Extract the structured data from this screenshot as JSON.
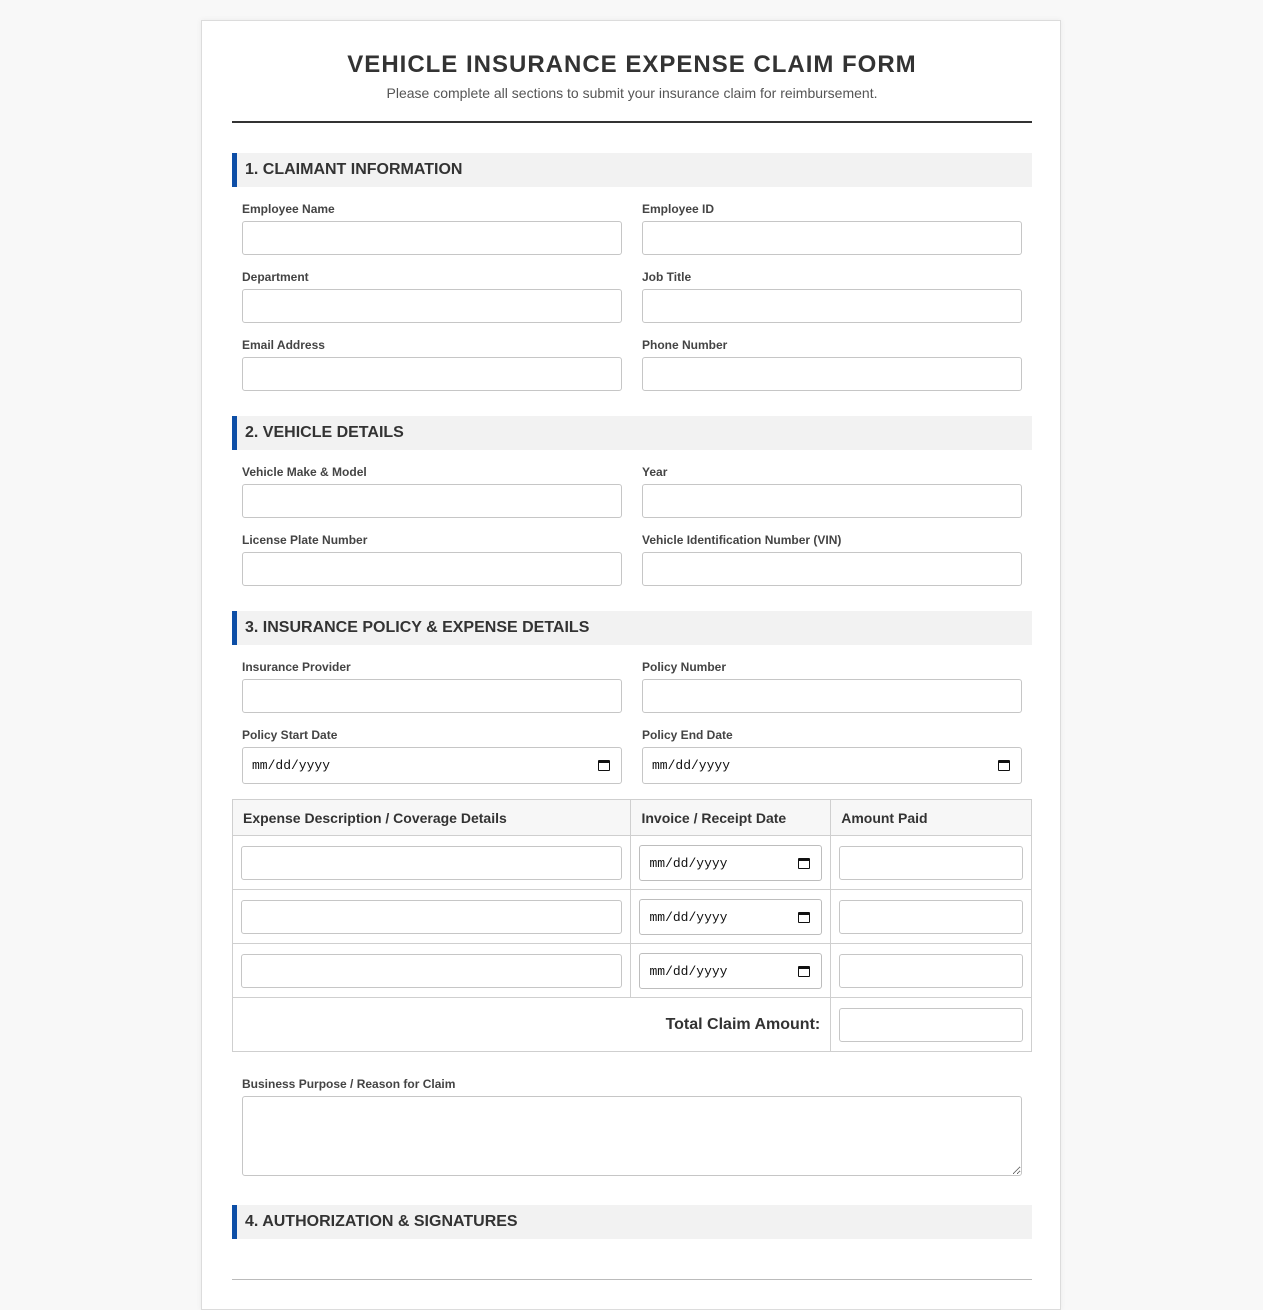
{
  "header": {
    "title": "VEHICLE INSURANCE EXPENSE CLAIM FORM",
    "subtitle": "Please complete all sections to submit your insurance claim for reimbursement."
  },
  "sections": {
    "claimant": {
      "heading": "1. CLAIMANT INFORMATION",
      "fields": {
        "employee_name": "Employee Name",
        "employee_id": "Employee ID",
        "department": "Department",
        "job_title": "Job Title",
        "email": "Email Address",
        "phone": "Phone Number"
      }
    },
    "vehicle": {
      "heading": "2. VEHICLE DETAILS",
      "fields": {
        "make_model": "Vehicle Make & Model",
        "year": "Year",
        "license_plate": "License Plate Number",
        "vin": "Vehicle Identification Number (VIN)"
      }
    },
    "policy": {
      "heading": "3. INSURANCE POLICY & EXPENSE DETAILS",
      "fields": {
        "provider": "Insurance Provider",
        "policy_number": "Policy Number",
        "start_date": "Policy Start Date",
        "end_date": "Policy End Date"
      },
      "date_placeholder": "mm/dd/yyyy",
      "table": {
        "headers": [
          "Expense Description / Coverage Details",
          "Invoice / Receipt Date",
          "Amount Paid"
        ],
        "total_label": "Total Claim Amount:"
      },
      "purpose_label": "Business Purpose / Reason for Claim"
    },
    "authorization": {
      "heading": "4. AUTHORIZATION & SIGNATURES"
    }
  },
  "colors": {
    "accent": "#0d4ea6",
    "section_bg": "#f2f2f2",
    "page_bg": "#f8f8f8"
  }
}
